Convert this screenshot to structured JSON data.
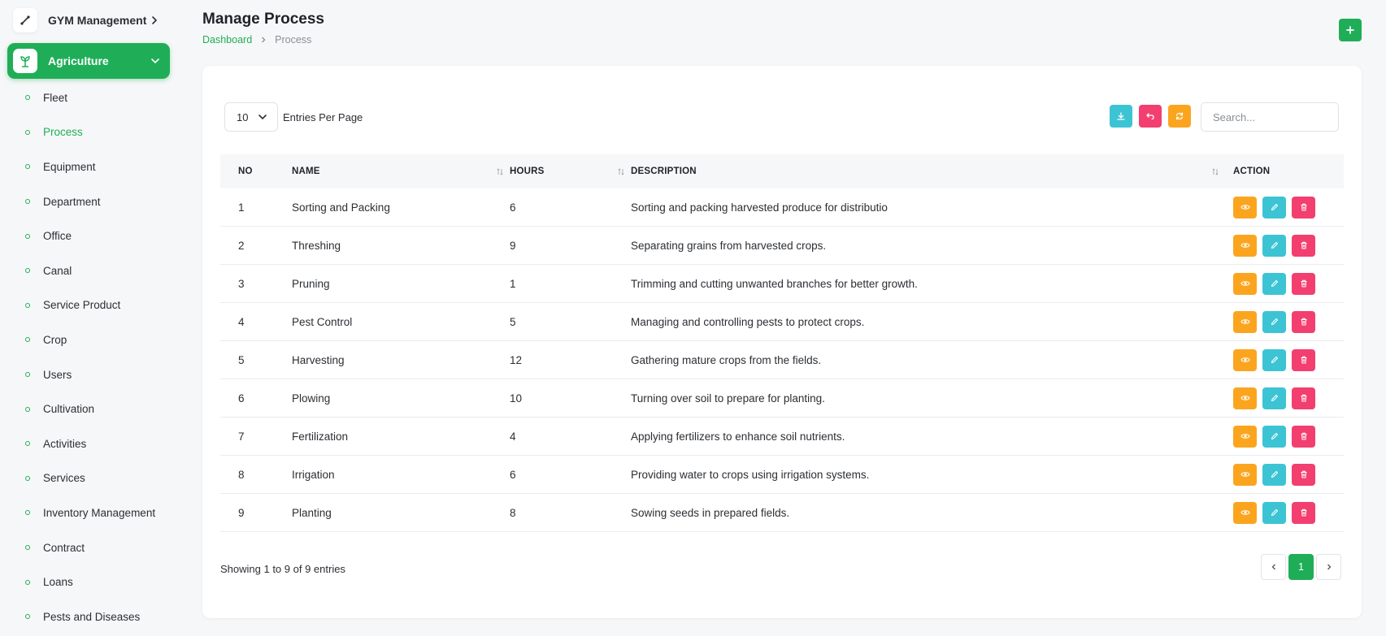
{
  "colors": {
    "accent": "#1fae57",
    "view": "#fba51f",
    "edit": "#3cc4d4",
    "delete": "#f23f70",
    "download": "#3cc4d4",
    "undo": "#f23f70",
    "refresh": "#fba51f"
  },
  "sidebar": {
    "gym": {
      "label": "GYM Management",
      "icon": "tool-icon"
    },
    "agriculture": {
      "label": "Agriculture",
      "icon": "plant-icon"
    },
    "items": [
      {
        "label": "Fleet"
      },
      {
        "label": "Process",
        "active": true
      },
      {
        "label": "Equipment"
      },
      {
        "label": "Department"
      },
      {
        "label": "Office"
      },
      {
        "label": "Canal"
      },
      {
        "label": "Service Product"
      },
      {
        "label": "Crop"
      },
      {
        "label": "Users"
      },
      {
        "label": "Cultivation"
      },
      {
        "label": "Activities"
      },
      {
        "label": "Services"
      },
      {
        "label": "Inventory Management"
      },
      {
        "label": "Contract"
      },
      {
        "label": "Loans"
      },
      {
        "label": "Pests and Diseases"
      }
    ]
  },
  "header": {
    "title": "Manage Process",
    "breadcrumb": {
      "home": "Dashboard",
      "current": "Process"
    },
    "add_label": "+"
  },
  "controls": {
    "entries_value": "10",
    "entries_label": "Entries Per Page",
    "search_placeholder": "Search..."
  },
  "table": {
    "columns": {
      "no": "NO",
      "name": "NAME",
      "hours": "HOURS",
      "description": "DESCRIPTION",
      "action": "ACTION"
    },
    "rows": [
      {
        "no": "1",
        "name": "Sorting and Packing",
        "hours": "6",
        "description": "Sorting and packing harvested produce for distributio"
      },
      {
        "no": "2",
        "name": "Threshing",
        "hours": "9",
        "description": "Separating grains from harvested crops."
      },
      {
        "no": "3",
        "name": "Pruning",
        "hours": "1",
        "description": "Trimming and cutting unwanted branches for better growth."
      },
      {
        "no": "4",
        "name": "Pest Control",
        "hours": "5",
        "description": "Managing and controlling pests to protect crops."
      },
      {
        "no": "5",
        "name": "Harvesting",
        "hours": "12",
        "description": "Gathering mature crops from the fields."
      },
      {
        "no": "6",
        "name": "Plowing",
        "hours": "10",
        "description": "Turning over soil to prepare for planting."
      },
      {
        "no": "7",
        "name": "Fertilization",
        "hours": "4",
        "description": "Applying fertilizers to enhance soil nutrients."
      },
      {
        "no": "8",
        "name": "Irrigation",
        "hours": "6",
        "description": "Providing water to crops using irrigation systems."
      },
      {
        "no": "9",
        "name": "Planting",
        "hours": "8",
        "description": "Sowing seeds in prepared fields."
      }
    ]
  },
  "footer": {
    "showing": "Showing 1 to 9 of 9 entries",
    "current_page": "1"
  }
}
